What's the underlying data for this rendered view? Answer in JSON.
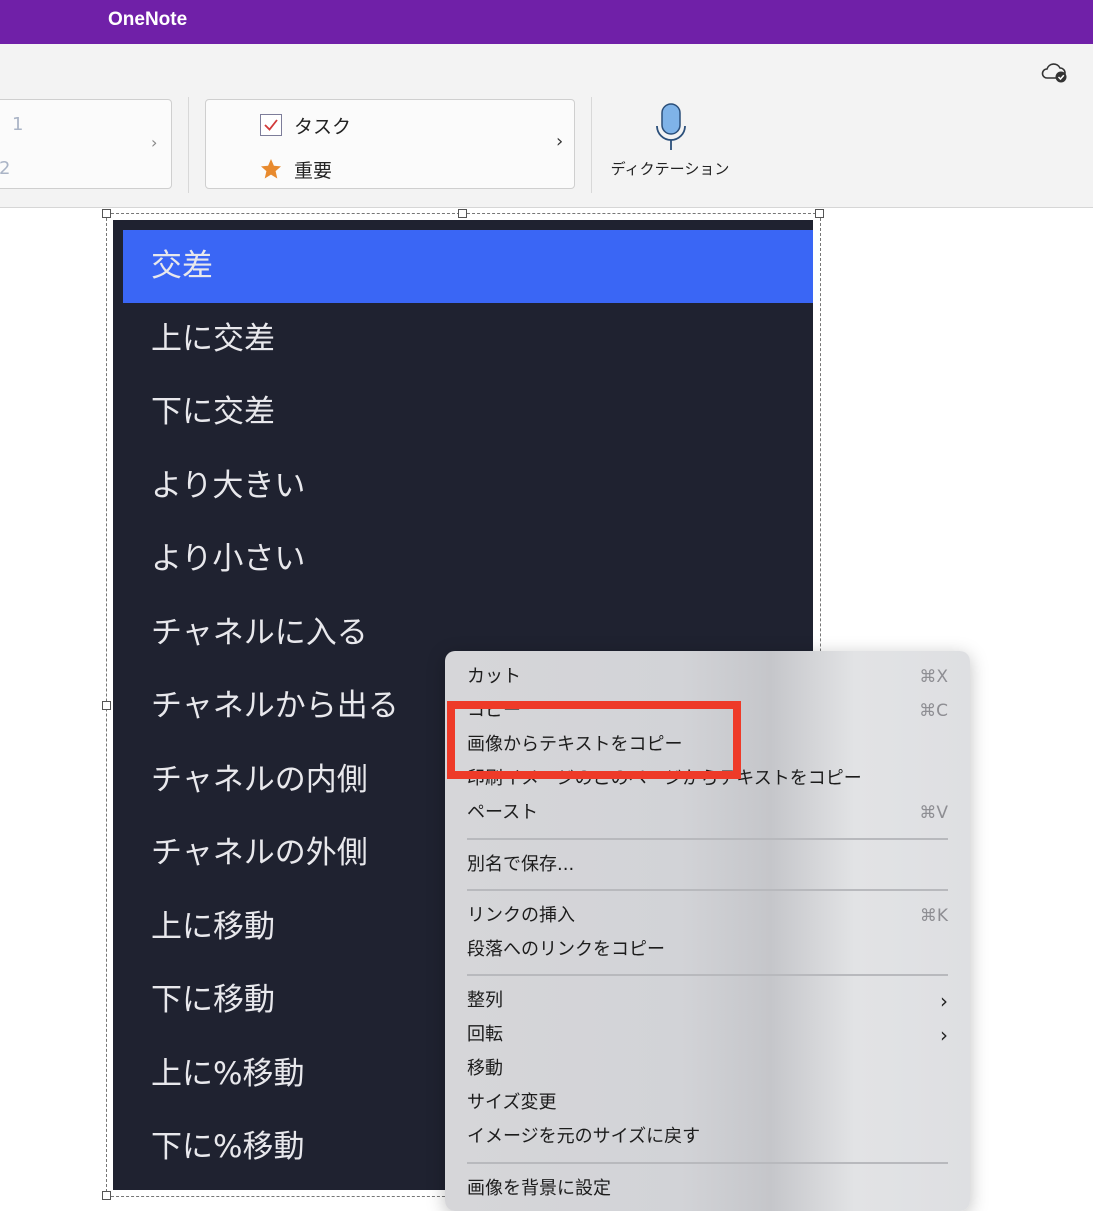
{
  "app": {
    "title": "OneNote"
  },
  "ribbon": {
    "list_numbers": [
      "1",
      "2"
    ],
    "tags": [
      {
        "label": "タスク",
        "icon": "checkbox-icon"
      },
      {
        "label": "重要",
        "icon": "star-icon"
      }
    ],
    "dictation_label": "ディクテーション",
    "colors": {
      "title_bar": "#7020a8",
      "star": "#e88a2e"
    }
  },
  "image_list": {
    "items": [
      "交差",
      "上に交差",
      "下に交差",
      "より大きい",
      "より小さい",
      "チャネルに入る",
      "チャネルから出る",
      "チャネルの内側",
      "チャネルの外側",
      "上に移動",
      "下に移動",
      "上に%移動",
      "下に%移動"
    ],
    "selected": "交差",
    "colors": {
      "background": "#1f2230",
      "selected": "#3a66f5"
    }
  },
  "context_menu": {
    "cut": {
      "label": "カット",
      "shortcut": "⌘X"
    },
    "copy": {
      "label": "コピー",
      "shortcut": "⌘C"
    },
    "copy_text_from_image": {
      "label": "画像からテキストをコピー"
    },
    "copy_text_all_pages": {
      "label": "印刷イメージのこのページからテキストをコピー"
    },
    "paste": {
      "label": "ペースト",
      "shortcut": "⌘V"
    },
    "save_as": {
      "label": "別名で保存..."
    },
    "insert_link": {
      "label": "リンクの挿入",
      "shortcut": "⌘K"
    },
    "copy_link_paragraph": {
      "label": "段落へのリンクをコピー"
    },
    "arrange": {
      "label": "整列"
    },
    "rotate": {
      "label": "回転"
    },
    "move": {
      "label": "移動"
    },
    "resize": {
      "label": "サイズ変更"
    },
    "restore_size": {
      "label": "イメージを元のサイズに戻す"
    },
    "set_background": {
      "label": "画像を背景に設定"
    }
  },
  "annotation": {
    "highlight_color": "#ee3a28"
  }
}
